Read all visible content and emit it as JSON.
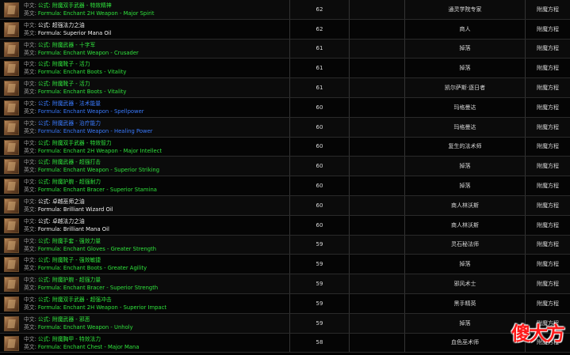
{
  "labels": {
    "cn_prefix": "中文:",
    "en_prefix": "英文:"
  },
  "rows": [
    {
      "cn": "公式: 附魔双手武器 - 特效精神",
      "en": "Formula: Enchant 2H Weapon - Major Spirit",
      "color": "#2fe33c",
      "level": "62",
      "source": "通灵学院专家",
      "type": "附魔方程"
    },
    {
      "cn": "公式: 超强法力之油",
      "en": "Formula: Superior Mana Oil",
      "color": "#f2f2f2",
      "level": "62",
      "source": "商人",
      "type": "附魔方程"
    },
    {
      "cn": "公式: 附魔武器 - 十字军",
      "en": "Formula: Enchant Weapon - Crusader",
      "color": "#2fe33c",
      "level": "61",
      "source": "掉落",
      "type": "附魔方程"
    },
    {
      "cn": "公式: 附魔靴子 - 活力",
      "en": "Formula: Enchant Boots - Vitality",
      "color": "#2fe33c",
      "level": "61",
      "source": "掉落",
      "type": "附魔方程"
    },
    {
      "cn": "公式: 附魔靴子 - 活力",
      "en": "Formula: Enchant Boots - Vitality",
      "color": "#2fe33c",
      "level": "61",
      "source": "凯尔萨斯·逐日者",
      "type": "附魔方程"
    },
    {
      "cn": "公式: 附魔武器 - 法术能量",
      "en": "Formula: Enchant Weapon - Spellpower",
      "color": "#3a7bff",
      "level": "60",
      "source": "玛格曼达",
      "type": "附魔方程"
    },
    {
      "cn": "公式: 附魔武器 - 治疗能力",
      "en": "Formula: Enchant Weapon - Healing Power",
      "color": "#3a7bff",
      "level": "60",
      "source": "玛格曼达",
      "type": "附魔方程"
    },
    {
      "cn": "公式: 附魔双手武器 - 特效智力",
      "en": "Formula: Enchant 2H Weapon - Major Intellect",
      "color": "#2fe33c",
      "level": "60",
      "source": "复生的法术师",
      "type": "附魔方程"
    },
    {
      "cn": "公式: 附魔武器 - 超强打击",
      "en": "Formula: Enchant Weapon - Superior Striking",
      "color": "#2fe33c",
      "level": "60",
      "source": "掉落",
      "type": "附魔方程"
    },
    {
      "cn": "公式: 附魔护腕 - 超强耐力",
      "en": "Formula: Enchant Bracer - Superior Stamina",
      "color": "#2fe33c",
      "level": "60",
      "source": "掉落",
      "type": "附魔方程"
    },
    {
      "cn": "公式: 卓越巫师之油",
      "en": "Formula: Brilliant Wizard Oil",
      "color": "#f2f2f2",
      "level": "60",
      "source": "商人林沃斯",
      "type": "附魔方程"
    },
    {
      "cn": "公式: 卓越法力之油",
      "en": "Formula: Brilliant Mana Oil",
      "color": "#f2f2f2",
      "level": "60",
      "source": "商人林沃斯",
      "type": "附魔方程"
    },
    {
      "cn": "公式: 附魔手套 - 强效力量",
      "en": "Formula: Enchant Gloves - Greater Strength",
      "color": "#2fe33c",
      "level": "59",
      "source": "灵石秘法师",
      "type": "附魔方程"
    },
    {
      "cn": "公式: 附魔靴子 - 强效敏捷",
      "en": "Formula: Enchant Boots - Greater Agility",
      "color": "#2fe33c",
      "level": "59",
      "source": "掉落",
      "type": "附魔方程"
    },
    {
      "cn": "公式: 附魔护腕 - 超强力量",
      "en": "Formula: Enchant Bracer - Superior Strength",
      "color": "#2fe33c",
      "level": "59",
      "source": "邪风术士",
      "type": "附魔方程"
    },
    {
      "cn": "公式: 附魔双手武器 - 超强冲击",
      "en": "Formula: Enchant 2H Weapon - Superior Impact",
      "color": "#2fe33c",
      "level": "59",
      "source": "黑手精英",
      "type": "附魔方程"
    },
    {
      "cn": "公式: 附魔武器 - 邪恶",
      "en": "Formula: Enchant Weapon - Unholy",
      "color": "#2fe33c",
      "level": "59",
      "source": "掉落",
      "type": "附魔方程"
    },
    {
      "cn": "公式: 附魔胸甲 - 特效法力",
      "en": "Formula: Enchant Chest - Major Mana",
      "color": "#2fe33c",
      "level": "58",
      "source": "血色巫术师",
      "type": "附魔方程"
    }
  ],
  "watermark": "傻大方"
}
